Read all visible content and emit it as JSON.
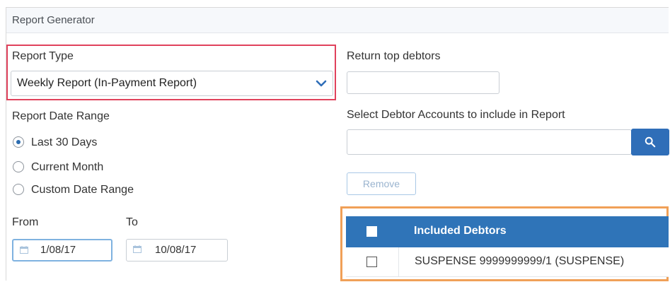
{
  "header": {
    "title": "Report Generator"
  },
  "report_type": {
    "label": "Report Type",
    "selected": "Weekly Report (In-Payment Report)"
  },
  "date_range": {
    "label": "Report Date Range",
    "options": [
      {
        "label": "Last 30 Days",
        "checked": true
      },
      {
        "label": "Current Month",
        "checked": false
      },
      {
        "label": "Custom Date Range",
        "checked": false
      }
    ]
  },
  "from": {
    "label": "From",
    "value": "1/08/17"
  },
  "to": {
    "label": "To",
    "value": "10/08/17"
  },
  "top_debtors": {
    "label": "Return top debtors",
    "value": ""
  },
  "debtor_accounts": {
    "label": "Select Debtor Accounts to include in Report",
    "value": "",
    "remove_label": "Remove"
  },
  "table": {
    "header": "Included Debtors",
    "rows": [
      {
        "name": "SUSPENSE 9999999999/1 (SUSPENSE)",
        "checked": false
      }
    ]
  },
  "colors": {
    "accent": "#2f74b8",
    "highlight_red": "#e0425c",
    "highlight_orange": "#f0a057"
  }
}
